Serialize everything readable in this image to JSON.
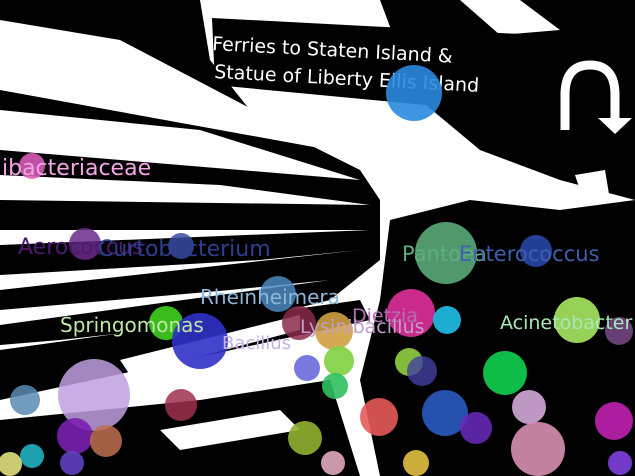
{
  "sign": {
    "line1": "Ferries to Staten Island &",
    "line2": "Statue of Liberty  Ellis Island"
  },
  "labels": [
    {
      "text": "ibacteriaceae",
      "color": "#f4a6e6"
    },
    {
      "text": "Aerococcus",
      "color": "#4b1a6e"
    },
    {
      "text": "Curtobacterium",
      "color": "#2f3f8f"
    },
    {
      "text": "Pantoea",
      "color": "#5fae7f"
    },
    {
      "text": "Enterococcus",
      "color": "#3f5fae"
    },
    {
      "text": "Rheinheimera",
      "color": "#8fb8d8"
    },
    {
      "text": "Springomonas",
      "color": "#bfe8a8"
    },
    {
      "text": "Dietzia",
      "color": "#b06fb0"
    },
    {
      "text": "Bacillus",
      "color": "#c8b0e0"
    },
    {
      "text": "Lysinibacillus",
      "color": "#c0a0c8"
    },
    {
      "text": "Acinetobacter",
      "color": "#a8e8b8"
    }
  ],
  "colors": {
    "background": "#ffffff",
    "foreground": "#000000"
  }
}
